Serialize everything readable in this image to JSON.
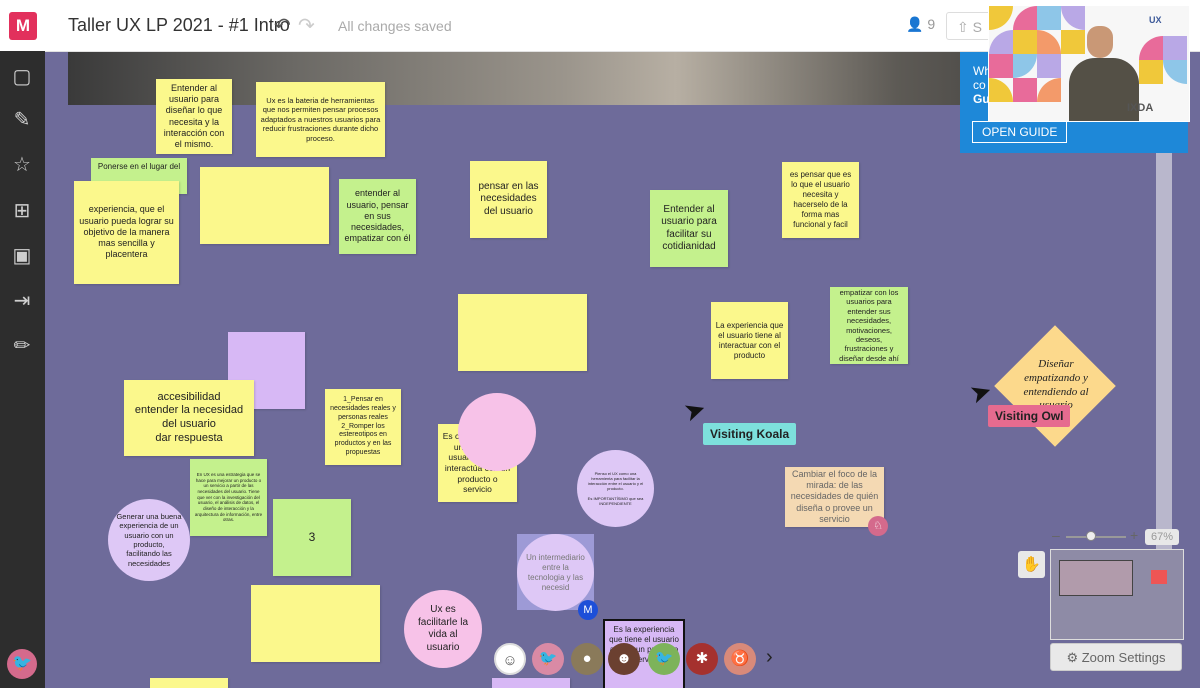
{
  "app": {
    "logo_letter": "M",
    "board_title": "Taller UX LP 2021 - #1 Intro",
    "status": "All changes saved",
    "users_count": "9",
    "share_label": "S"
  },
  "sidebar": {
    "items": [
      "sticky-note",
      "comment",
      "star",
      "grid",
      "image",
      "import",
      "pen"
    ]
  },
  "guide": {
    "line1": "Wh",
    "line2": "co",
    "line3": "Gu",
    "button": "OPEN GUIDE"
  },
  "video": {
    "brand_small": "UX",
    "brand": "IXDA"
  },
  "notes": {
    "n1": "Entender al usuario para diseñar lo que necesita y la interacción con el mismo.",
    "n2": "Ux es la bateria de herramientas que nos permiten pensar procesos adaptados a nuestros usuarios para reducir frustraciones durante dicho proceso.",
    "n3": "Ponerse en el lugar del",
    "n4": "experiencia, que el usuario pueda lograr su objetivo de la manera mas sencilla y placentera",
    "n6": "entender al usuario, pensar en sus necesidades, empatizar con él",
    "n7": "pensar en las necesidades del usuario",
    "n8": "Entender al usuario para facilitar su cotidianidad",
    "n9": "es pensar que es lo que el usuario necesita y hacerselo de la forma mas funcional y facil",
    "n11": "La experiencia que el usuario tiene al interactuar con el producto",
    "n12": "empatizar con los usuarios para entender sus necesidades, motivaciones, deseos, frustraciones y diseñar desde ahí",
    "n14": "accesibilidad\nentender la necesidad del usuario\ndar respuesta",
    "n15": "1_Pensar en necesidades reales y personas reales\n2_Romper los estereotipos en productos y en las propuestas",
    "n16": "Es cómo se siente una persona usuaria cuando interactúa con un producto o servicio",
    "n17": "En UX es una estrategia que se hace para mejorar un producto o un servicio a partir de las necesidades del usuario. Tiene que ver con la investigación del usuario, el análisis de datos, el diseño de interacción y la arquitectura de información, entre otras.",
    "n18": "3",
    "n19": "Cambiar el foco de la mirada: de las necesidades de quién diseña o provee un servicio",
    "n20": "Es la experiencia que tiene el usuario al usar un producto o servicio"
  },
  "circles": {
    "c2": "Generar una buena experiencia de un usuario con un producto, facilitando las necesidades",
    "c3": "Pienso el UX como una herramienta para facilitar la interacción entre el usuario y el producto.\n\nEs IMPORTANTÍSIMO que sea INDEPENDIENTE",
    "c4": "Un intermediario entre la tecnologia y las necesid",
    "c5": "Ux es facilitarle la vida al usuario"
  },
  "diamond": {
    "text": "Diseñar empatizando y entendiendo al usuario"
  },
  "cursors": {
    "koala": "Visiting Koala",
    "owl": "Visiting Owl"
  },
  "zoom": {
    "minus": "–",
    "plus": "+",
    "percent": "67%",
    "settings": "Zoom Settings"
  },
  "colors": {
    "canvas": "#6e6b9a",
    "brand": "#e2305c",
    "guide": "#1e88d8",
    "sticky_yellow": "#fbf88c",
    "sticky_green": "#c4f18d",
    "sticky_purple": "#d7b8f5"
  },
  "collaborators": [
    "smiley",
    "bird-pink",
    "photo",
    "masked",
    "bird-green",
    "lobster",
    "goat"
  ]
}
